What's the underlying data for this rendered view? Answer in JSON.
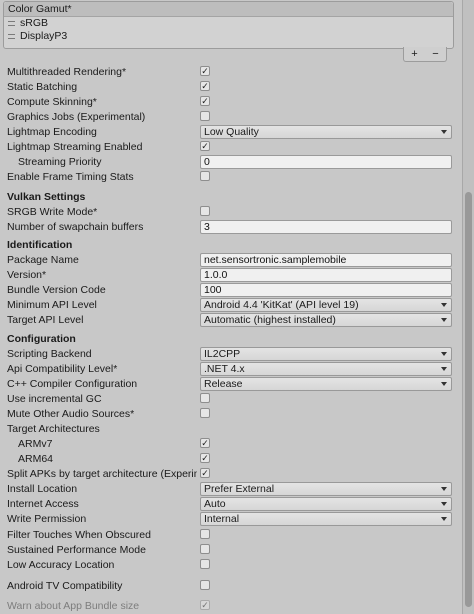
{
  "color_gamut": {
    "title": "Color Gamut*",
    "items": [
      "sRGB",
      "DisplayP3"
    ],
    "add_label": "+",
    "remove_label": "−"
  },
  "rendering": {
    "multithreaded": {
      "label": "Multithreaded Rendering*",
      "checked": true
    },
    "static_batching": {
      "label": "Static Batching",
      "checked": true
    },
    "compute_skinning": {
      "label": "Compute Skinning*",
      "checked": true
    },
    "graphics_jobs": {
      "label": "Graphics Jobs (Experimental)",
      "checked": false
    },
    "lightmap_encoding": {
      "label": "Lightmap Encoding",
      "value": "Low Quality"
    },
    "lightmap_streaming": {
      "label": "Lightmap Streaming Enabled",
      "checked": true
    },
    "streaming_priority": {
      "label": "Streaming Priority",
      "value": "0"
    },
    "frame_timing": {
      "label": "Enable Frame Timing Stats",
      "checked": false
    }
  },
  "vulkan": {
    "header": "Vulkan Settings",
    "srgb_write": {
      "label": "SRGB Write Mode*",
      "checked": false
    },
    "swapchain": {
      "label": "Number of swapchain buffers",
      "value": "3"
    }
  },
  "identification": {
    "header": "Identification",
    "package_name": {
      "label": "Package Name",
      "value": "net.sensortronic.samplemobile"
    },
    "version": {
      "label": "Version*",
      "value": "1.0.0"
    },
    "bundle_code": {
      "label": "Bundle Version Code",
      "value": "100"
    },
    "min_api": {
      "label": "Minimum API Level",
      "value": "Android 4.4 'KitKat' (API level 19)"
    },
    "target_api": {
      "label": "Target API Level",
      "value": "Automatic (highest installed)"
    }
  },
  "configuration": {
    "header": "Configuration",
    "scripting_backend": {
      "label": "Scripting Backend",
      "value": "IL2CPP"
    },
    "api_compat": {
      "label": "Api Compatibility Level*",
      "value": ".NET 4.x"
    },
    "cpp_config": {
      "label": "C++ Compiler Configuration",
      "value": "Release"
    },
    "incremental_gc": {
      "label": "Use incremental GC",
      "checked": false
    },
    "mute_audio": {
      "label": "Mute Other Audio Sources*",
      "checked": false
    },
    "target_arch": {
      "label": "Target Architectures"
    },
    "armv7": {
      "label": "ARMv7",
      "checked": true
    },
    "arm64": {
      "label": "ARM64",
      "checked": true
    },
    "split_apks": {
      "label": "Split APKs by target architecture (Experimental)",
      "checked": true
    },
    "install_location": {
      "label": "Install Location",
      "value": "Prefer External"
    },
    "internet_access": {
      "label": "Internet Access",
      "value": "Auto"
    },
    "write_permission": {
      "label": "Write Permission",
      "value": "Internal"
    },
    "filter_touches": {
      "label": "Filter Touches When Obscured",
      "checked": false
    },
    "sustained_perf": {
      "label": "Sustained Performance Mode",
      "checked": false
    },
    "low_accuracy": {
      "label": "Low Accuracy Location",
      "checked": false
    },
    "android_tv": {
      "label": "Android TV Compatibility",
      "checked": false
    },
    "warn_bundle": {
      "label": "Warn about App Bundle size",
      "checked": true
    }
  }
}
